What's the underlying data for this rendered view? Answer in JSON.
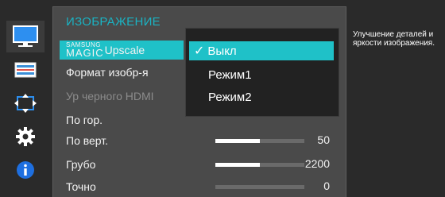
{
  "menu": {
    "title": "ИЗОБРАЖЕНИЕ",
    "items": [
      {
        "label_brand_small": "SAMSUNG",
        "label_brand_main": "MAGIC",
        "label": "Upscale"
      },
      {
        "label": "Формат изобр-я"
      },
      {
        "label": "Ур черного HDMI"
      },
      {
        "label": "По гор."
      },
      {
        "label": "По верт.",
        "value": "50",
        "level": 0.5
      },
      {
        "label": "Грубо",
        "value": "2200",
        "level": 0.5
      },
      {
        "label": "Точно",
        "value": "0",
        "level": 0.0
      }
    ]
  },
  "dropdown": {
    "check_glyph": "✓",
    "options": [
      "Выкл",
      "Режим1",
      "Режим2"
    ],
    "selected": "Выкл"
  },
  "help": {
    "text": "Улучшение деталей и яркости изображения."
  },
  "rail": {
    "icons": [
      "monitor-icon",
      "settings-panel-icon",
      "position-arrows-icon",
      "gear-icon",
      "info-icon"
    ],
    "active": "monitor-icon"
  },
  "colors": {
    "accent": "#1fc1c8",
    "title": "#1ab3c3",
    "panel": "#4a4a4a",
    "background": "#2a2a2a",
    "info_blue": "#1e6fe0",
    "monitor_blue": "#2d8ff0"
  }
}
